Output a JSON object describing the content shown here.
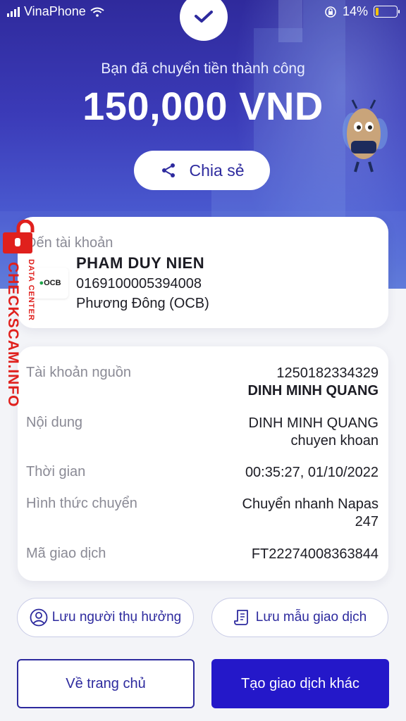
{
  "status_bar": {
    "carrier": "VinaPhone",
    "battery_percent": "14%",
    "battery_level": 0.14
  },
  "hero": {
    "success_text": "Bạn đã chuyển tiền thành công",
    "amount": "150,000 VND",
    "share_label": "Chia sẻ"
  },
  "recipient": {
    "label": "Đến tài khoản",
    "bank_logo_text": "OCB",
    "name": "PHAM DUY NIEN",
    "account_number": "0169100005394008",
    "bank_name": "Phương Đông (OCB)"
  },
  "details": {
    "source_label": "Tài khoản nguồn",
    "source_account": "1250182334329",
    "source_name": "DINH MINH QUANG",
    "content_label": "Nội dung",
    "content_line1": "DINH MINH QUANG",
    "content_line2": "chuyen khoan",
    "time_label": "Thời gian",
    "time_value": "00:35:27, 01/10/2022",
    "method_label": "Hình thức chuyển",
    "method_line1": "Chuyển nhanh Napas",
    "method_line2": "247",
    "txn_label": "Mã giao dịch",
    "txn_value": "FT22274008363844"
  },
  "actions": {
    "save_beneficiary": "Lưu người thụ hưởng",
    "save_template": "Lưu mẫu giao dịch",
    "home": "Về trang chủ",
    "new_transaction": "Tạo giao dịch khác"
  },
  "watermark": {
    "main": "CHECKSCAM.INFO",
    "sub": "DATA CENTER"
  },
  "colors": {
    "primary": "#2418c9",
    "brand_text": "#2d2a9e",
    "hero_top": "#2f2a9c",
    "watermark": "#e0201d",
    "battery": "#f5c400"
  }
}
